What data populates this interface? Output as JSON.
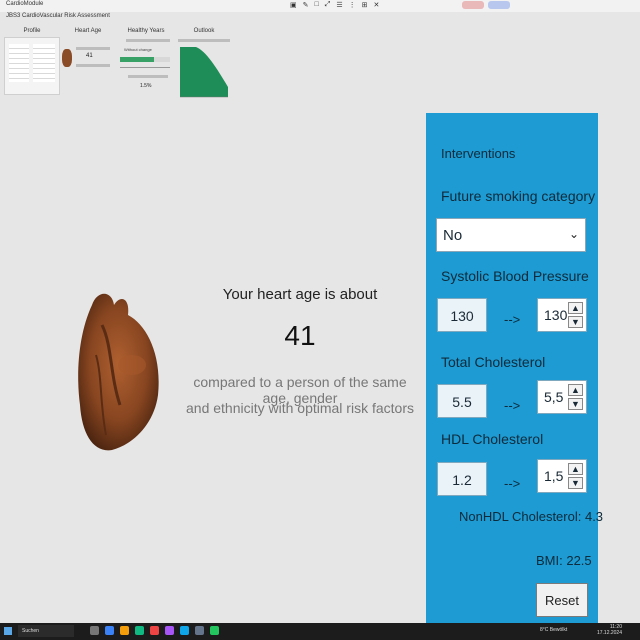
{
  "window": {
    "app_title": "CardioModule",
    "subtitle": "JBS3 CardioVascular Risk Assessment",
    "controls": [
      "▣",
      "✎",
      "□",
      "⤢",
      "☰",
      "⋮",
      "⊞",
      "✕"
    ]
  },
  "thumbnails": [
    {
      "label": "Profile"
    },
    {
      "label": "Heart Age",
      "value": "41"
    },
    {
      "label": "Healthy Years",
      "text_a": "Without change",
      "text_b": "1.5%"
    },
    {
      "label": "Outlook"
    }
  ],
  "center": {
    "heading": "Your heart age is about",
    "value": "41",
    "line1": "compared to a person of the same age, gender",
    "line2": "and ethnicity with optimal risk factors"
  },
  "panel": {
    "title": "Interventions",
    "smoking_label": "Future smoking category",
    "smoking_value": "No",
    "sbp_label": "Systolic Blood Pressure",
    "sbp_current": "130",
    "sbp_target": "130",
    "arrow": "-->",
    "chol_label": "Total Cholesterol",
    "chol_current": "5.5",
    "chol_target": "5,5",
    "hdl_label": "HDL Cholesterol",
    "hdl_current": "1.2",
    "hdl_target": "1,5",
    "non_hdl": "NonHDL Cholesterol: 4.3",
    "bmi": "BMI: 22.5",
    "reset_label": "Reset"
  },
  "taskbar": {
    "search_text": "Suchen",
    "tray_text": "8°C  Bewölkt",
    "time": "11:20",
    "date": "17.12.2024"
  },
  "colors": {
    "panel_blue": "#1e9bd2",
    "panel_text": "#0d2b3c",
    "background": "#e6e6e6"
  }
}
